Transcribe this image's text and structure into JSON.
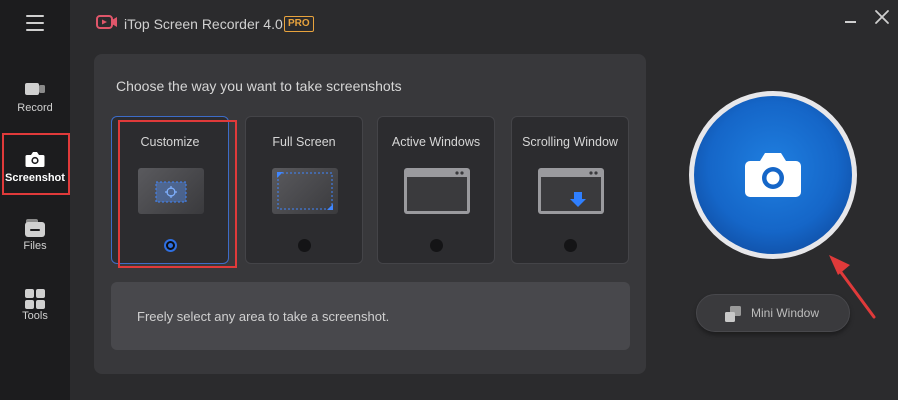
{
  "app": {
    "title": "iTop Screen Recorder 4.0",
    "badge": "PRO"
  },
  "sidebar": {
    "items": [
      {
        "label": "Record",
        "icon": "video-camera-icon"
      },
      {
        "label": "Screenshot",
        "icon": "camera-icon",
        "active": true
      },
      {
        "label": "Files",
        "icon": "folder-icon"
      },
      {
        "label": "Tools",
        "icon": "grid-icon"
      }
    ]
  },
  "panel": {
    "heading": "Choose the way you want to take screenshots",
    "options": [
      {
        "label": "Customize",
        "selected": true
      },
      {
        "label": "Full Screen",
        "selected": false
      },
      {
        "label": "Active Windows",
        "selected": false
      },
      {
        "label": "Scrolling Window",
        "selected": false
      }
    ],
    "description": "Freely select any area to take a screenshot."
  },
  "capture": {
    "icon": "camera-icon"
  },
  "mini_window": {
    "label": "Mini Window"
  },
  "colors": {
    "accent": "#1566c8",
    "highlight": "#e03a3a",
    "pro": "#e8a33d"
  }
}
